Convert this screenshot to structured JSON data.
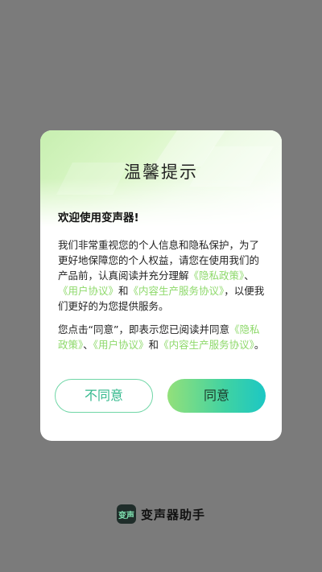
{
  "dialog": {
    "title": "温馨提示",
    "greeting": "欢迎使用变声器!",
    "para1": {
      "t1": "我们非常重视您的个人信息和隐私保护，为了更好地保障您的个人权益，请您在使用我们的产品前，认真阅读并充分理解",
      "link_privacy": "《隐私政策》",
      "sep": "、",
      "link_user": "《用户协议》",
      "and": "和",
      "link_content": "《内容生产服务协议》",
      "t2": "，以便我们更好的为您提供服务。"
    },
    "para2": {
      "t1": "您点击“同意”，即表示您已阅读并同意",
      "link_privacy": "《隐私政策》",
      "sep": "、",
      "link_user": "《用户协议》",
      "and": "和",
      "link_content": "《内容生产服务协议》",
      "t2": "。"
    },
    "disagree_label": "不同意",
    "agree_label": "同意"
  },
  "footer": {
    "logo_text": "变声",
    "app_name": "变声器助手"
  },
  "colors": {
    "link": "#8ed96b",
    "agree_gradient_start": "#93e07a",
    "agree_gradient_end": "#1cc7c4",
    "overlay": "#7b7b7b"
  }
}
